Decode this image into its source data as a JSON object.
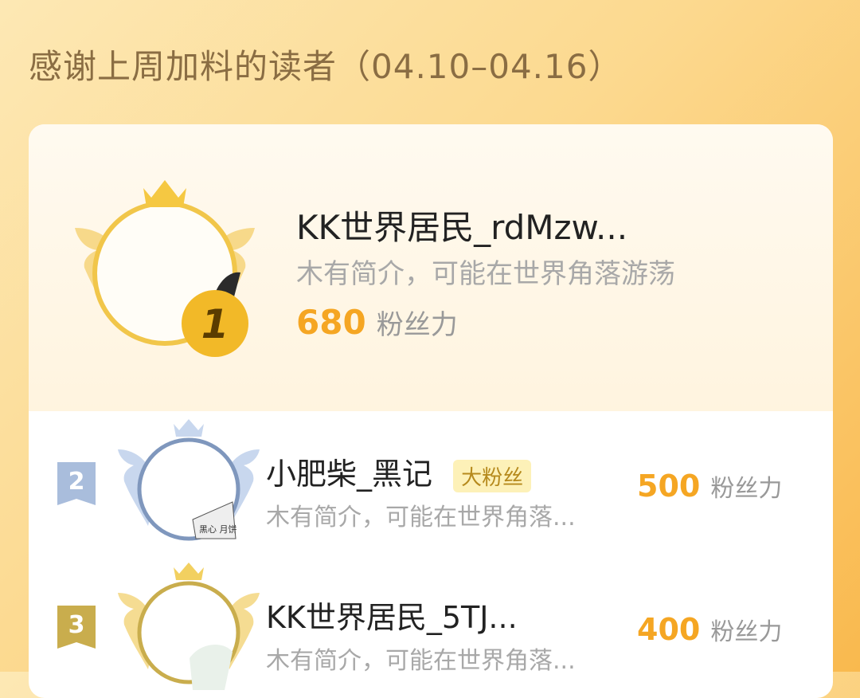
{
  "page": {
    "title": "感谢上周加料的读者（04.10–04.16）"
  },
  "first": {
    "rank": "1",
    "name": "KK世界居民_rdMzw...",
    "bio": "木有简介，可能在世界角落游荡",
    "score": "680",
    "unit": "粉丝力"
  },
  "rows": [
    {
      "rank": "2",
      "name": "小肥柴_黑记",
      "badge": "大粉丝",
      "bio": "木有简介，可能在世界角落...",
      "score": "500",
      "unit": "粉丝力",
      "avatar_caption": "黑心 月饼"
    },
    {
      "rank": "3",
      "name": "KK世界居民_5TJ...",
      "bio": "木有简介，可能在世界角落...",
      "score": "400",
      "unit": "粉丝力"
    }
  ],
  "colors": {
    "accent": "#f5a623",
    "gold_frame": "#f1c64a",
    "silver_frame": "#7f97bd",
    "bronze_frame": "#c9ad4d",
    "badge_bg": "#fdf1b8"
  },
  "icons": {
    "crown": "crown-icon",
    "wings": "wings-icon",
    "rank_flag": "rank-flag-icon"
  }
}
